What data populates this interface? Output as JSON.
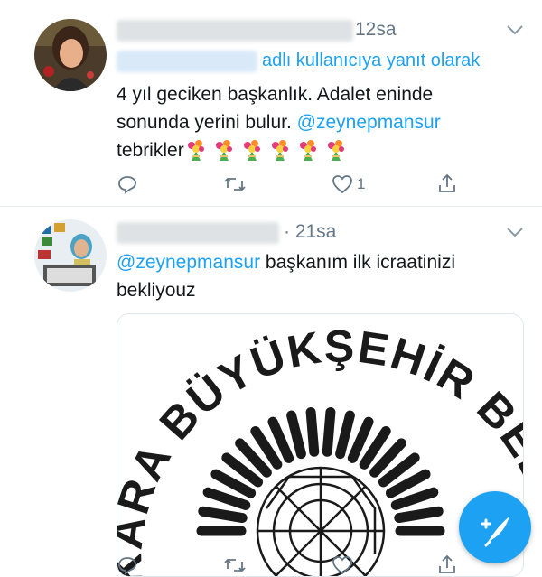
{
  "tweet1": {
    "time": "12sa",
    "reply_text": "adlı kullanıcıya yanıt olarak",
    "text_line1": "4 yıl geciken başkanlık. Adalet eninde",
    "text_line2_pre": "sonunda yerini bulur.",
    "mention": "@zeynepmansur",
    "text_line3": "tebrikler",
    "likes": "1"
  },
  "tweet2": {
    "time": "· 21sa",
    "mention": "@zeynepmansur",
    "text_line1_rest": "başkanım ilk icraatinizi",
    "text_line2": "bekliyouz",
    "logo_text": "KARA BÜYÜKŞEHİR BELE"
  },
  "icons": [
    "reply-icon",
    "retweet-icon",
    "like-icon",
    "share-icon",
    "chevron-down-icon",
    "compose-tweet-icon"
  ],
  "colors": {
    "accent": "#1da1f2",
    "secondary_text": "#657786",
    "divider": "#e6ecf0"
  }
}
